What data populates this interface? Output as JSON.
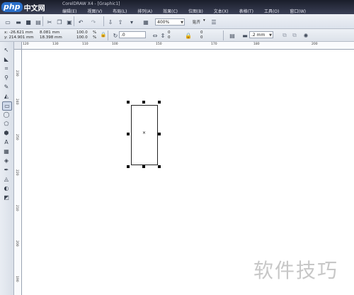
{
  "app": {
    "logo_php": "php",
    "logo_cn": "中文网",
    "title": "CorelDRAW X4 - [Graphic1]"
  },
  "menu": [
    "编辑(E)",
    "视图(V)",
    "布局(L)",
    "排列(A)",
    "效果(C)",
    "位图(B)",
    "文本(X)",
    "表格(T)",
    "工具(O)",
    "窗口(W)"
  ],
  "toolbar1": {
    "zoom": "400%",
    "snap": "贴齐",
    "snap_arrow": "▾"
  },
  "toolbar2": {
    "x": "x: -26.621 mm",
    "y": "y: 214.901 mm",
    "w": "8.081 mm",
    "h": "18.398 mm",
    "scale_w": "100.0",
    "scale_h": "100.0",
    "pct": "%",
    "rotation": ".0",
    "corner_tl": "0",
    "corner_tr": "0",
    "corner_bl": "0",
    "corner_br": "0",
    "outline": ".2 mm"
  },
  "ruler": {
    "h_ticks": [
      "120",
      "130",
      "110",
      "100",
      "150",
      "170",
      "180",
      "200"
    ],
    "v_ticks": [
      "230",
      "240",
      "250",
      "220",
      "210",
      "200",
      "190"
    ]
  },
  "watermark": "软件技巧"
}
